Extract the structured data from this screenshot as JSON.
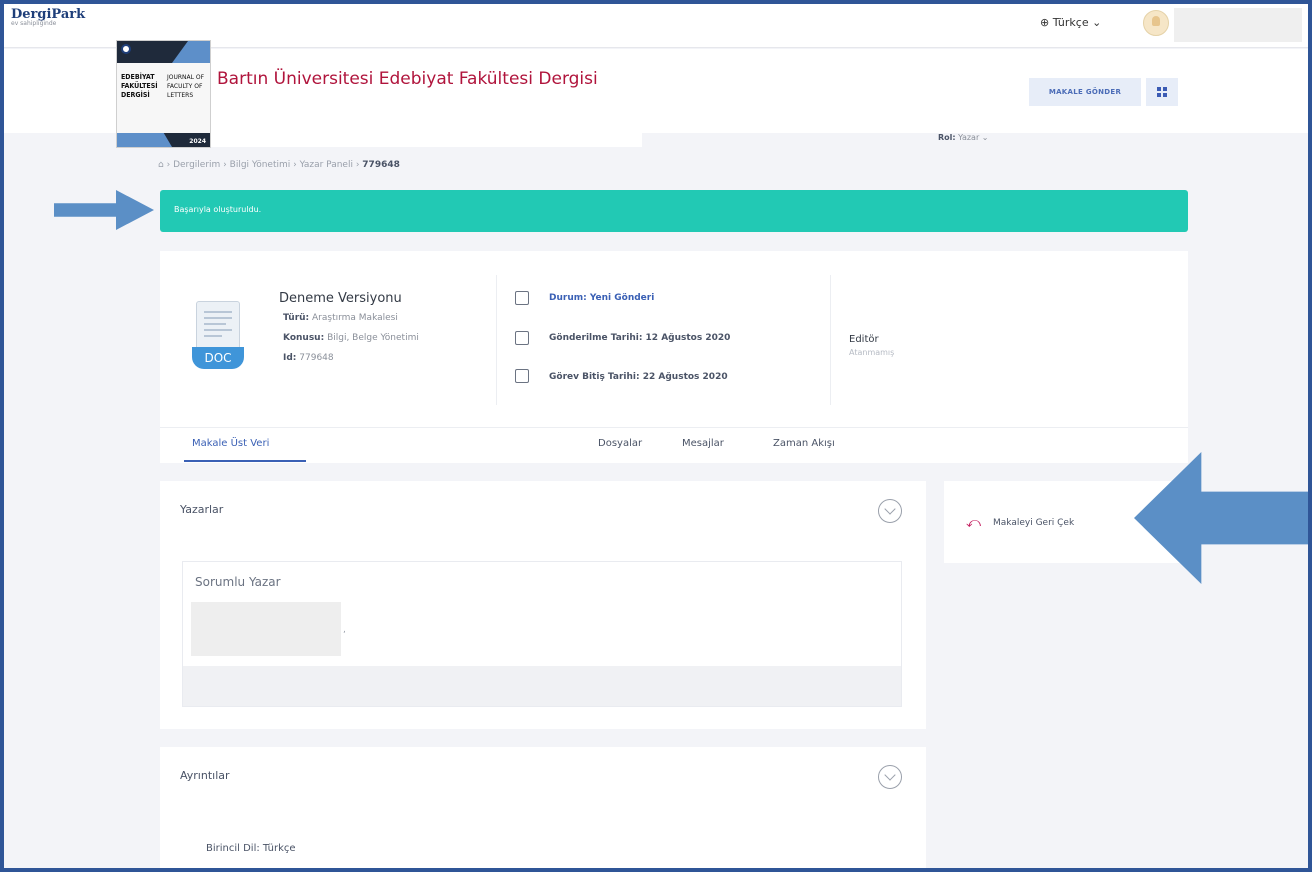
{
  "topbar": {
    "brand": "DergiPark",
    "brand_tag": "ev sahipliğinde",
    "language": "Türkçe"
  },
  "journal": {
    "title": "Bartın Üniversitesi Edebiyat Fakültesi Dergisi",
    "cover_left": [
      "EDEBİYAT",
      "FAKÜLTESİ",
      "DERGİSİ"
    ],
    "cover_right": [
      "JOURNAL OF",
      "FACULTY OF",
      "LETTERS"
    ],
    "cover_year": "2024"
  },
  "toolbar": {
    "role_label": "Rol:",
    "role_value": "Yazar",
    "submit_label": "MAKALE GÖNDER"
  },
  "breadcrumb": {
    "items": [
      "Dergilerim",
      "Bilgi Yönetimi",
      "Yazar Paneli"
    ],
    "current": "779648"
  },
  "alert": {
    "message": "Başarıyla oluşturuldu."
  },
  "article": {
    "title": "Deneme Versiyonu",
    "type_label": "Türü:",
    "type_value": "Araştırma Makalesi",
    "topic_label": "Konusu:",
    "topic_value": "Bilgi, Belge Yönetimi",
    "id_label": "Id:",
    "id_value": "779648",
    "status": "Durum: Yeni Gönderi",
    "submitted": "Gönderilme Tarihi: 12 Ağustos 2020",
    "due": "Görev Bitiş Tarihi: 22 Ağustos 2020",
    "editor_label": "Editör",
    "editor_value": "Atanmamış",
    "doc_badge": "DOC"
  },
  "tabs": [
    {
      "label": "Makale Üst Veri"
    },
    {
      "label": "Dosyalar"
    },
    {
      "label": "Mesajlar"
    },
    {
      "label": "Zaman Akışı"
    }
  ],
  "authors": {
    "title": "Yazarlar",
    "responsible": "Sorumlu Yazar",
    "separator": ","
  },
  "actions": {
    "withdraw": "Makaleyi Geri Çek"
  },
  "details": {
    "title": "Ayrıntılar",
    "primary_language": "Birincil Dil: Türkçe"
  },
  "colors": {
    "success": "#22c9b4",
    "accent": "#3a60b5",
    "arrow": "#5b8fc6",
    "journal_title": "#b0143c"
  }
}
